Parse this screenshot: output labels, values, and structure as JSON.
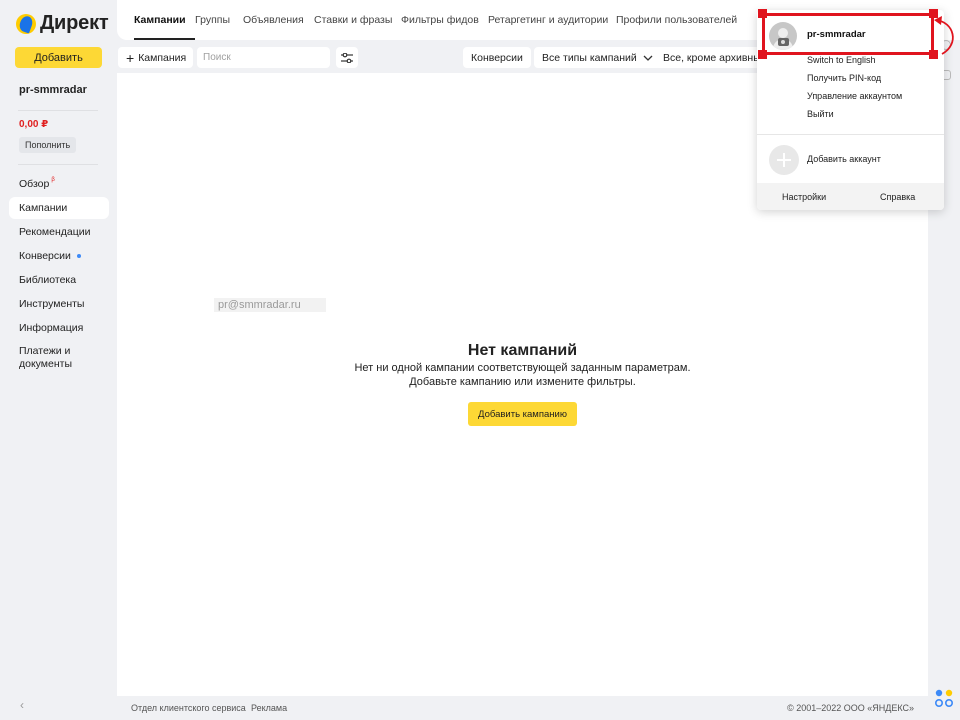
{
  "brand": {
    "name": "Директ"
  },
  "sidebar": {
    "add_label": "Добавить",
    "username": "pr-smmradar",
    "balance": "0,00 ₽",
    "topup_label": "Пополнить",
    "items": [
      {
        "label": "Обзор",
        "badge": "β"
      },
      {
        "label": "Кампании",
        "active": true
      },
      {
        "label": "Рекомендации"
      },
      {
        "label": "Конверсии",
        "dot": true
      },
      {
        "label": "Библиотека"
      },
      {
        "label": "Инструменты"
      },
      {
        "label": "Информация"
      },
      {
        "label": "Платежи и документы"
      }
    ],
    "collapse_glyph": "‹"
  },
  "header": {
    "tabs": [
      {
        "label": "Кампании",
        "active": true
      },
      {
        "label": "Группы"
      },
      {
        "label": "Объявления"
      },
      {
        "label": "Ставки и фразы"
      },
      {
        "label": "Фильтры фидов"
      },
      {
        "label": "Ретаргетинг и аудитории"
      },
      {
        "label": "Профили пользователей"
      }
    ]
  },
  "toolbar": {
    "campaign_label": "Кампания",
    "search_placeholder": "Поиск",
    "conversions_label": "Конверсии",
    "types_label": "Все типы кампаний",
    "status_label": "Все, кроме архивных"
  },
  "main": {
    "email": "pr@smmradar.ru",
    "empty_title": "Нет кампаний",
    "empty_line1": "Нет ни одной кампании соответствующей заданным параметрам.",
    "empty_line2": "Добавьте кампанию или измените фильтры.",
    "add_campaign_label": "Добавить кампанию"
  },
  "footer": {
    "support": "Отдел клиентского сервиса",
    "ads": "Реклама",
    "copyright": "© 2001–2022 ООО «ЯНДЕКС»"
  },
  "account_menu": {
    "username": "pr-smmradar",
    "items": [
      "Switch to English",
      "Получить PIN-код",
      "Управление аккаунтом",
      "Выйти"
    ],
    "add_account": "Добавить аккаунт",
    "settings": "Настройки",
    "help": "Справка"
  },
  "colors": {
    "accent_yellow": "#fdd835",
    "annotation_red": "#e0141e",
    "balance_red": "#e01f1f",
    "background": "#f0f1f4"
  }
}
